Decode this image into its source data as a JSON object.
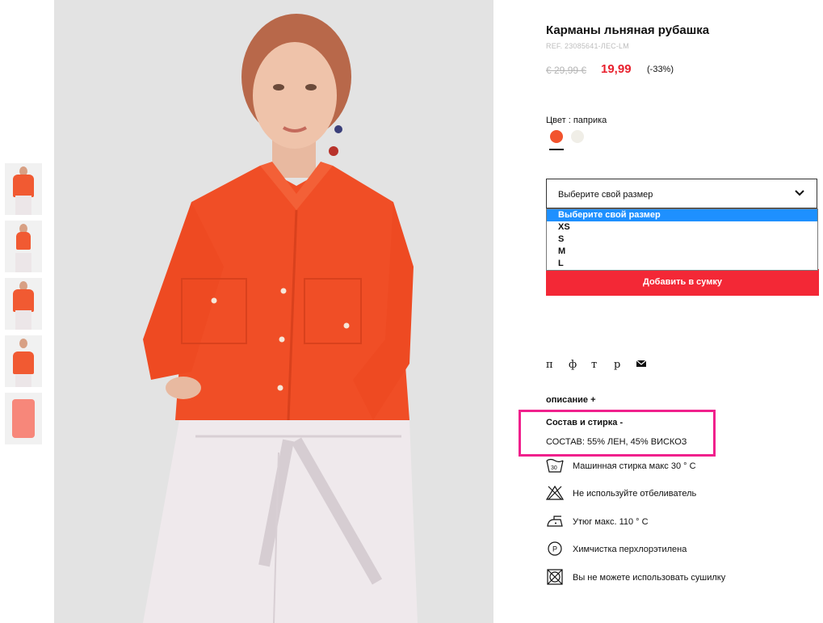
{
  "product": {
    "title": "Карманы льняная рубашка",
    "ref": "REF. 23085641-ЛЕС-LM",
    "old_price": "€ 29,99 €",
    "new_price": "19,99",
    "discount": "(-33%)"
  },
  "color": {
    "label": "Цвет : паприка",
    "swatches": [
      "#f2532d",
      "#f0eee7"
    ]
  },
  "size": {
    "selected": "Выберите свой размер",
    "options": [
      "Выберите свой размер",
      "XS",
      "S",
      "M",
      "L"
    ]
  },
  "add_to_bag": "Добавить в сумку",
  "social": [
    "п",
    "ф",
    "т",
    "р"
  ],
  "description_label": "описание +",
  "composition": {
    "title": "Состав и стирка -",
    "text": "СОСТАВ: 55% ЛЕН, 45% ВИСКОЗ"
  },
  "care": [
    {
      "icon": "wash-30-icon",
      "text": "Машинная стирка макс 30 ° C"
    },
    {
      "icon": "no-bleach-icon",
      "text": "Не используйте отбеливатель"
    },
    {
      "icon": "iron-icon",
      "text": "Утюг макс. 110 ° C"
    },
    {
      "icon": "dry-clean-p-icon",
      "text": "Химчистка перхлорэтилена"
    },
    {
      "icon": "no-tumble-dry-icon",
      "text": "Вы не можете использовать сушилку"
    }
  ],
  "care_wash_temp": "30",
  "dry_clean_letter": "P",
  "accent_colors": {
    "price": "#e8202d",
    "button": "#f32836",
    "highlight": "#f0208c",
    "dropdown_active": "#1e90ff"
  }
}
